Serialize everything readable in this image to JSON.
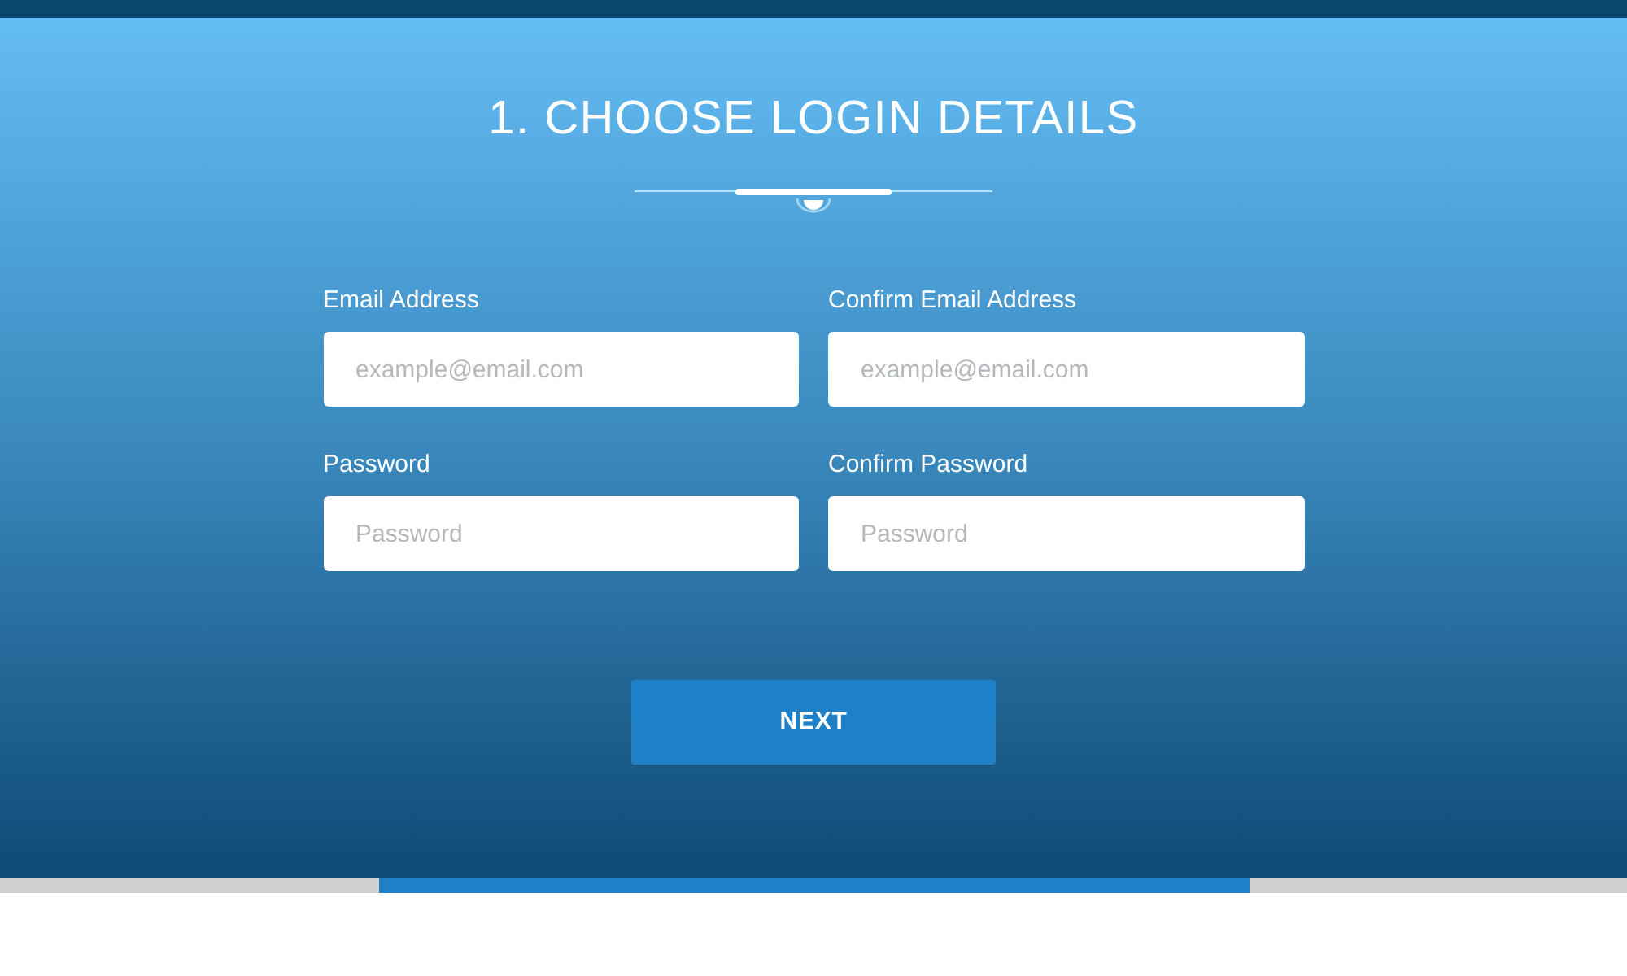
{
  "title": "1. CHOOSE LOGIN DETAILS",
  "fields": [
    {
      "label": "Email Address",
      "placeholder": "example@email.com"
    },
    {
      "label": "Confirm Email Address",
      "placeholder": "example@email.com"
    },
    {
      "label": "Password",
      "placeholder": "Password"
    },
    {
      "label": "Confirm Password",
      "placeholder": "Password"
    }
  ],
  "button": "NEXT"
}
